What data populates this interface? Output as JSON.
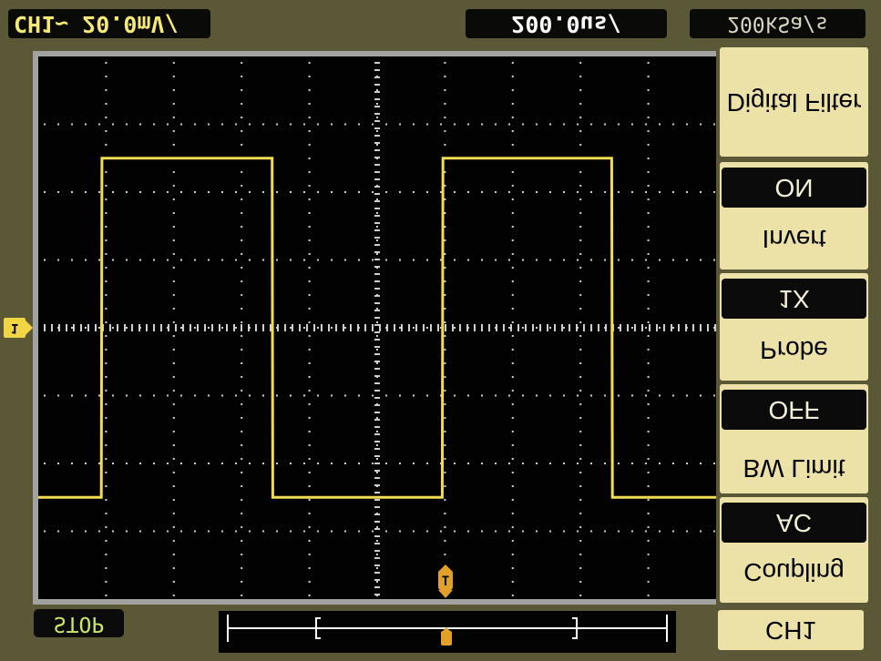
{
  "top_bar": {
    "channel_scale": "CH1~ 20.0mV/",
    "time_scale": "200.0us/",
    "sample_rate": "200kSa/s"
  },
  "status": {
    "run_state": "STOP"
  },
  "menu": {
    "items": [
      {
        "label": "Digital Filter",
        "value": "ON"
      },
      {
        "label": "Invert",
        "value": "1X"
      },
      {
        "label": "Probe",
        "value": "OFF"
      },
      {
        "label": "BW Limit",
        "value": "AC"
      },
      {
        "label": "Coupling",
        "value": ""
      }
    ],
    "channel_button": "CH1"
  },
  "markers": {
    "channel_marker": "1",
    "trigger_marker": "T"
  },
  "colors": {
    "trace": "#f2dc55",
    "grid_dots": "#cfcfcf",
    "trigger": "#e0a02a",
    "background": "#5b5838",
    "menu_bg": "#ece2a8"
  },
  "chart_data": {
    "type": "line",
    "title": "",
    "xlabel": "",
    "ylabel": "",
    "x_divisions": 10,
    "y_divisions": 8,
    "x": [
      0,
      0.93,
      0.94,
      3.45,
      3.46,
      5.96,
      5.97,
      8.46,
      8.47,
      10
    ],
    "series": [
      {
        "values": [
          -2.5,
          -2.5,
          2.5,
          2.5,
          -2.5,
          -2.5,
          2.5,
          2.5,
          -2.5,
          -2.5
        ]
      }
    ],
    "xlim": [
      0,
      10
    ],
    "ylim": [
      -4,
      4
    ]
  }
}
